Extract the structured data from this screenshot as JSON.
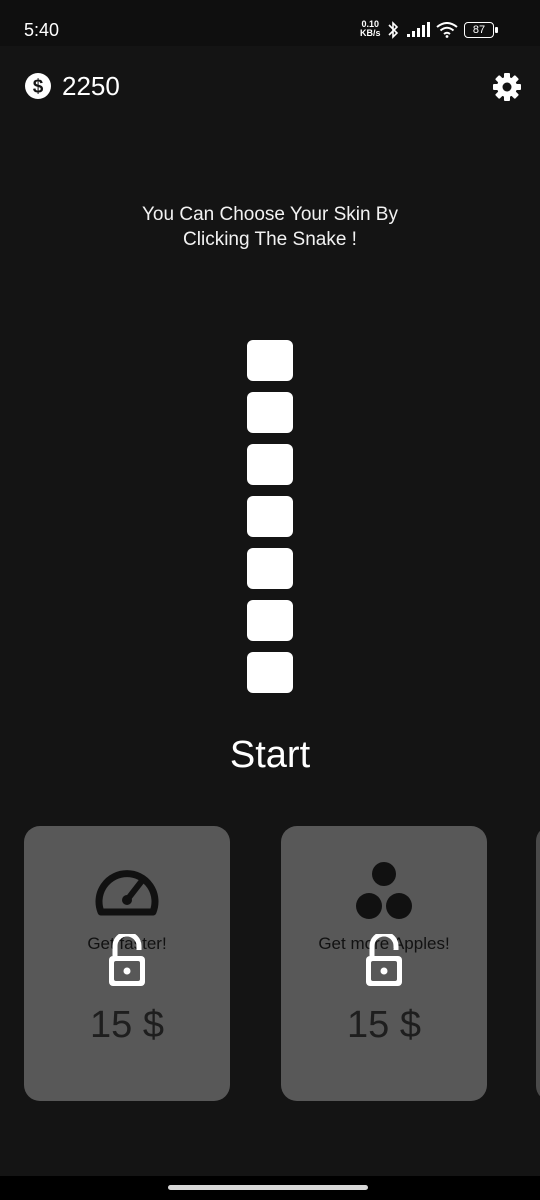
{
  "status": {
    "time": "5:40",
    "net_speed_value": "0.10",
    "net_speed_unit": "KB/s",
    "battery": "87"
  },
  "header": {
    "coins": "2250",
    "coin_icon": "dollar-coin-icon",
    "settings_icon": "gear-icon"
  },
  "hint": {
    "line1": "You Can Choose Your Skin By",
    "line2": "Clicking The Snake !"
  },
  "snake": {
    "segments": 7
  },
  "start_label": "Start",
  "upgrades": [
    {
      "label": "Get faster!",
      "icon": "speedometer-icon",
      "price": "15 $",
      "locked": true
    },
    {
      "label": "Get more Apples!",
      "icon": "apples-icon",
      "price": "15 $",
      "locked": true
    }
  ],
  "colors": {
    "background": "#141414",
    "card": "#585858",
    "snake": "#ffffff"
  }
}
